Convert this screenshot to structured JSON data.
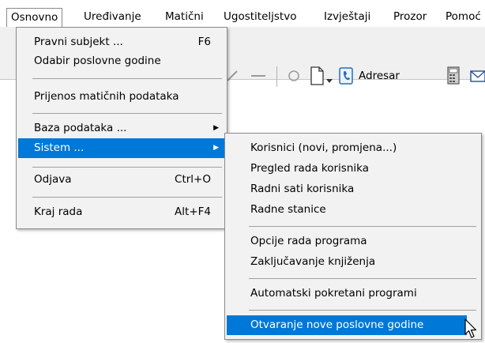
{
  "menubar": {
    "items": [
      "Osnovno",
      "Uređivanje",
      "Matični",
      "Ugostiteljstvo",
      "Izvještaji",
      "Prozor",
      "Pomoć"
    ]
  },
  "toolbar": {
    "adresar_label": "Adresar"
  },
  "osnovno_menu": {
    "items": [
      {
        "label": "Pravni subjekt ...",
        "shortcut": "F6"
      },
      {
        "label": "Odabir poslovne godine",
        "shortcut": ""
      },
      {
        "label": "Prijenos matičnih podataka",
        "shortcut": ""
      },
      {
        "label": "Baza podataka ...",
        "shortcut": ""
      },
      {
        "label": "Sistem ...",
        "shortcut": ""
      },
      {
        "label": "Odjava",
        "shortcut": "Ctrl+O"
      },
      {
        "label": "Kraj rada",
        "shortcut": "Alt+F4"
      }
    ]
  },
  "sistem_menu": {
    "items": [
      "Korisnici (novi, promjena...)",
      "Pregled rada korisnika",
      "Radni sati korisnika",
      "Radne stanice",
      "Opcije rada programa",
      "Zaključavanje knjiženja",
      "Automatski pokretani programi",
      "Otvaranje nove poslovne godine"
    ]
  },
  "colors": {
    "highlight": "#0078d7",
    "menu_bg": "#f2f2f2"
  }
}
